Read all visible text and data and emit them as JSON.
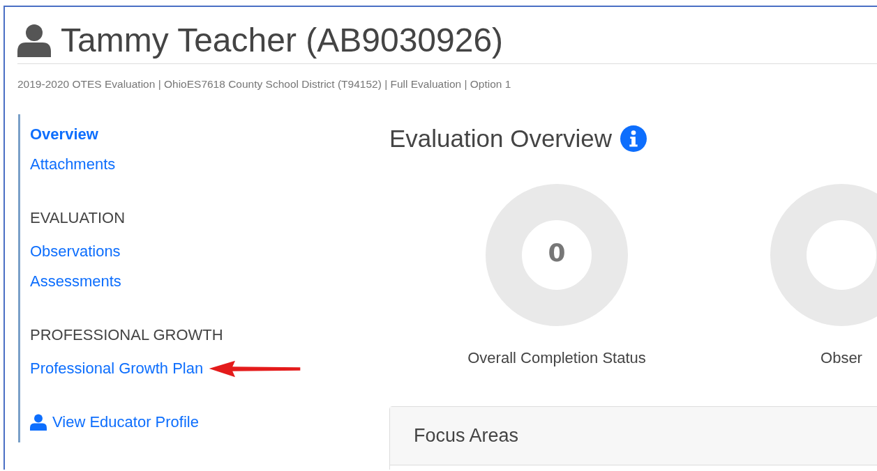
{
  "header": {
    "title": "Tammy Teacher (AB9030926)",
    "subtitle": "2019-2020 OTES Evaluation | OhioES7618 County School District (T94152) | Full Evaluation | Option 1"
  },
  "sidebar": {
    "items": [
      {
        "kind": "link",
        "label": "Overview",
        "selected": true
      },
      {
        "kind": "link",
        "label": "Attachments",
        "selected": false
      },
      {
        "kind": "heading",
        "label": "EVALUATION"
      },
      {
        "kind": "link",
        "label": "Observations",
        "selected": false
      },
      {
        "kind": "link",
        "label": "Assessments",
        "selected": false
      },
      {
        "kind": "heading",
        "label": "PROFESSIONAL GROWTH"
      },
      {
        "kind": "link",
        "label": "Professional Growth Plan",
        "selected": false,
        "annotated": true
      },
      {
        "kind": "profile",
        "label": "View Educator Profile",
        "selected": false
      }
    ]
  },
  "main": {
    "title": "Evaluation Overview",
    "donuts": [
      {
        "value": "0",
        "label": "Overall Completion Status"
      },
      {
        "label": "Obser"
      }
    ],
    "panel": {
      "title": "Focus Areas"
    }
  }
}
